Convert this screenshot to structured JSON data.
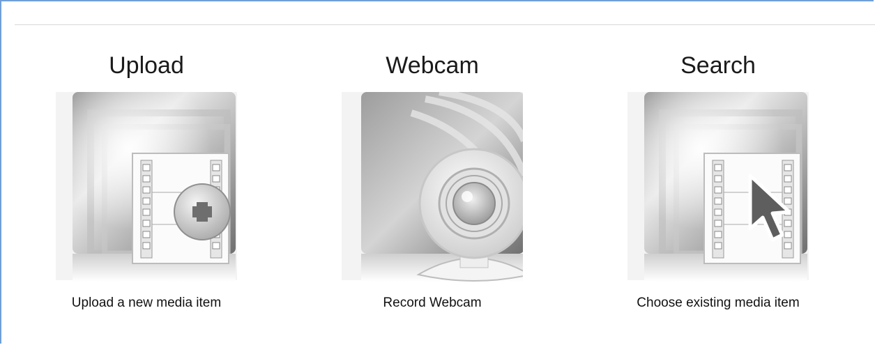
{
  "options": [
    {
      "title": "Upload",
      "caption": "Upload a new media item",
      "icon": "upload-media-icon"
    },
    {
      "title": "Webcam",
      "caption": "Record Webcam",
      "icon": "webcam-icon"
    },
    {
      "title": "Search",
      "caption": "Choose existing media item",
      "icon": "search-media-icon"
    }
  ],
  "colors": {
    "frame_border": "#6f9fd8",
    "divider": "#d8d8d8"
  }
}
